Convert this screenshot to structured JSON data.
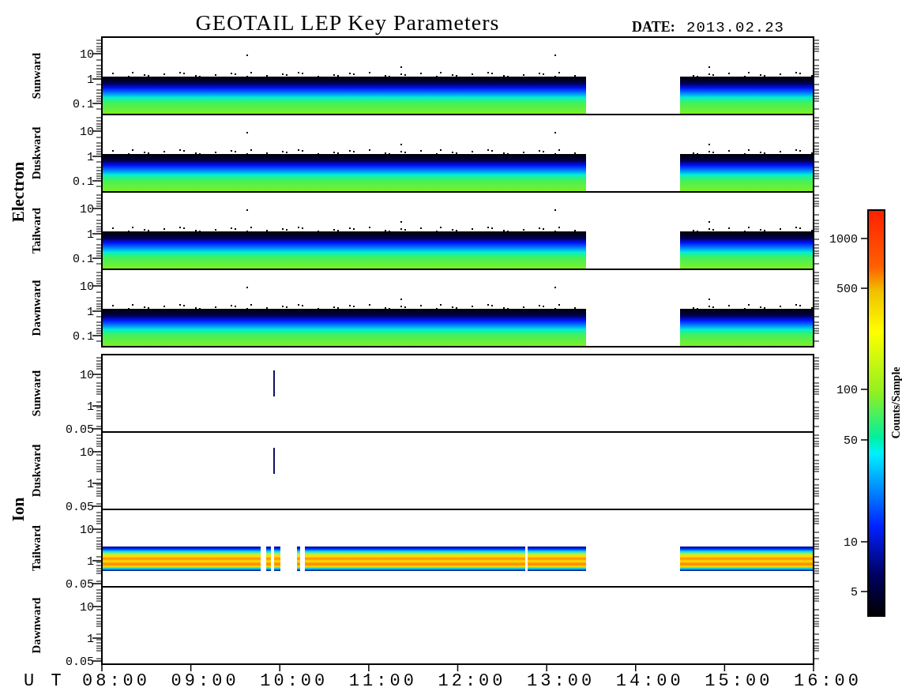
{
  "title": "GEOTAIL LEP Key Parameters",
  "date": {
    "label": "DATE:",
    "value": "2013.02.23"
  },
  "groups": [
    {
      "species": "Electron",
      "panels": [
        {
          "direction": "Sunward",
          "kind": "spectrum",
          "yticks": [
            "10",
            "1",
            "0.1"
          ]
        },
        {
          "direction": "Duskward",
          "kind": "spectrum",
          "yticks": [
            "10",
            "1",
            "0.1"
          ]
        },
        {
          "direction": "Tailward",
          "kind": "spectrum",
          "yticks": [
            "10",
            "1",
            "0.1"
          ]
        },
        {
          "direction": "Dawnward",
          "kind": "spectrum",
          "yticks": [
            "10",
            "1",
            "0.1"
          ]
        }
      ]
    },
    {
      "species": "Ion",
      "panels": [
        {
          "direction": "Sunward",
          "kind": "spike",
          "yticks": [
            "10",
            "1",
            "0.05"
          ]
        },
        {
          "direction": "Duskward",
          "kind": "spike",
          "yticks": [
            "10",
            "1",
            "0.05"
          ]
        },
        {
          "direction": "Tailward",
          "kind": "band",
          "yticks": [
            "10",
            "1",
            "0.05"
          ]
        },
        {
          "direction": "Dawnward",
          "kind": "empty",
          "yticks": [
            "10",
            "1",
            "0.05"
          ]
        }
      ]
    }
  ],
  "x_axis": {
    "label": "U T",
    "ticks": [
      "08:00",
      "09:00",
      "10:00",
      "11:00",
      "12:00",
      "13:00",
      "14:00",
      "15:00",
      "16:00"
    ]
  },
  "colorbar": {
    "label": "Counts/Sample",
    "ticks": [
      "1000",
      "500",
      "100",
      "50",
      "10",
      "5"
    ]
  }
}
